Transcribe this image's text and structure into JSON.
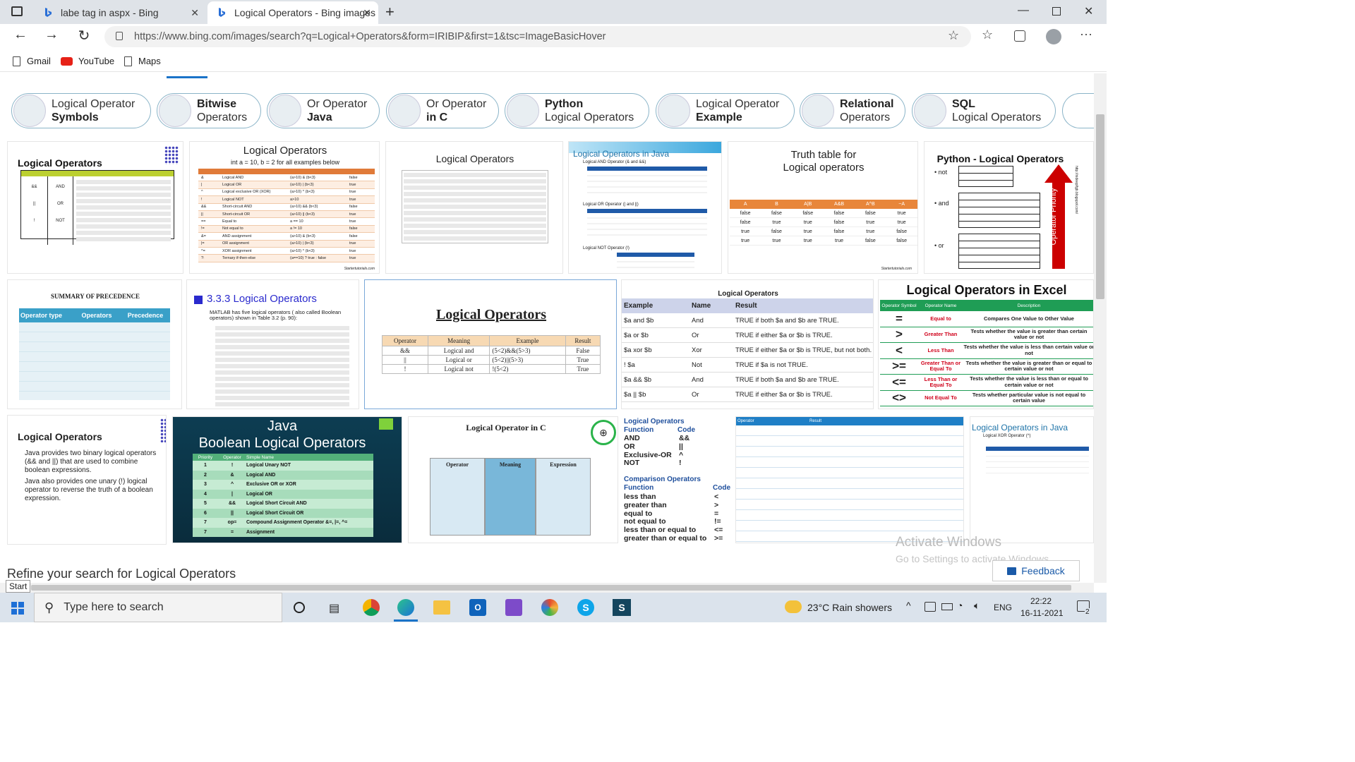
{
  "browser": {
    "tabs": [
      {
        "title": "labe tag in aspx - Bing",
        "active": false
      },
      {
        "title": "Logical Operators - Bing images",
        "active": true
      }
    ],
    "url": "https://www.bing.com/images/search?q=Logical+Operators&form=IRIBIP&first=1&tsc=ImageBasicHover",
    "bookmarks": [
      "Gmail",
      "YouTube",
      "Maps"
    ]
  },
  "related": [
    {
      "line1": "Logical Operator",
      "line2": "Symbols",
      "bold": 2
    },
    {
      "line1": "Bitwise",
      "line2": "Operators",
      "bold": 1
    },
    {
      "line1": "Or Operator",
      "line2": "Java",
      "bold": 2
    },
    {
      "line1": "Or Operator",
      "line2": "in C",
      "bold": 2
    },
    {
      "line1": "Python",
      "line2": "Logical Operators",
      "bold": 1
    },
    {
      "line1": "Logical Operator",
      "line2": "Example",
      "bold": 2
    },
    {
      "line1": "Relational",
      "line2": "Operators",
      "bold": 1
    },
    {
      "line1": "SQL",
      "line2": "Logical Operators",
      "bold": 1
    }
  ],
  "tiles": {
    "t1": {
      "title": "Logical Operators"
    },
    "t2": {
      "title": "Logical Operators",
      "sub": "int  a = 10, b = 2 for all examples below",
      "footer": "Startertutorials.com"
    },
    "t3": {
      "title": "Logical Operators"
    },
    "t4": {
      "title": "Logical Operators in Java",
      "a": "Logical AND Operator (& and &&)",
      "b": "Logical OR Operator (| and ||)",
      "c": "Logical NOT Operator (!)"
    },
    "t5": {
      "title": "Truth table for Logical operators",
      "footer": "Startertutorials.com"
    },
    "t6": {
      "title": "Python - Logical Operators",
      "side": "Operator Priority",
      "url": "http://nideeplfgb.blogspot.com/"
    },
    "t7": {
      "title": "SUMMARY OF PRECEDENCE",
      "cols": [
        "Operator type",
        "Operators",
        "Precedence"
      ]
    },
    "t8": {
      "title": "3.3.3 Logical Operators",
      "intro": "MATLAB has five logical operators ( also called Boolean operators) shown in Table 3.2 (p. 90):"
    },
    "t9": {
      "title": "Logical Operators",
      "cols": [
        "Operator",
        "Meaning",
        "Example",
        "Result"
      ]
    },
    "t10": {
      "title": "Logical Operators",
      "cols": [
        "Example",
        "Name",
        "Result"
      ]
    },
    "t11": {
      "title": "Logical Operators in Excel",
      "cols": [
        "Operator Symbol",
        "Operator Name",
        "Description"
      ]
    },
    "t12": {
      "title": "Logical Operators",
      "b1": "Java provides two binary logical operators (&& and ||) that are used to combine boolean expressions.",
      "b2": "Java also provides one unary (!) logical operator to reverse the truth of a boolean expression."
    },
    "t13": {
      "title1": "Java",
      "title2": "Boolean Logical Operators",
      "cols": [
        "Priority",
        "Operator",
        "Simple Name"
      ]
    },
    "t14": {
      "title": "Logical  Operator in C",
      "cols": [
        "Operator",
        "Meaning",
        "Expression"
      ]
    },
    "t15": {
      "h1": "Logical Operators",
      "h2": "Comparison Operators",
      "func": "Function",
      "code": "Code"
    },
    "t16": {
      "c1": "Operator",
      "c2": "Result"
    },
    "t17": {
      "title": "Logical Operators in Java",
      "sub": "Logical XOR Operator (^)"
    }
  },
  "t2rows": [
    [
      "&",
      "Logical AND",
      "(a>10) & (b<3)",
      "false"
    ],
    [
      "|",
      "Logical OR",
      "(a>10) | (b<3)",
      "true"
    ],
    [
      "^",
      "Logical exclusive OR (XOR)",
      "(a>10) ^ (b<3)",
      "true"
    ],
    [
      "!",
      "Logical NOT",
      "a>10",
      "true"
    ],
    [
      "&&",
      "Short-circuit AND",
      "(a>10) && (b<3)",
      "false"
    ],
    [
      "||",
      "Short-circuit OR",
      "(a>10) || (b<3)",
      "true"
    ],
    [
      "==",
      "Equal to",
      "a == 10",
      "true"
    ],
    [
      "!=",
      "Not equal to",
      "a != 10",
      "false"
    ],
    [
      "&=",
      "AND assignment",
      "(a>10) & (b<3)",
      "false"
    ],
    [
      "|=",
      "OR assignment",
      "(a>10) | (b<3)",
      "true"
    ],
    [
      "^=",
      "XOR assignment",
      "(a>10) ^ (b<3)",
      "true"
    ],
    [
      "?:",
      "Ternary if-then-else",
      "(a==10) ? true : false",
      "true"
    ]
  ],
  "t5head": [
    "A",
    "B",
    "A|B",
    "A&B",
    "A^B",
    "~A"
  ],
  "t5rows": [
    [
      "false",
      "false",
      "false",
      "false",
      "false",
      "true"
    ],
    [
      "false",
      "true",
      "true",
      "false",
      "true",
      "true"
    ],
    [
      "true",
      "false",
      "true",
      "false",
      "true",
      "false"
    ],
    [
      "true",
      "true",
      "true",
      "true",
      "false",
      "false"
    ]
  ],
  "t9rows": [
    [
      "&&",
      "Logical and",
      "(5<2)&&(5>3)",
      "False"
    ],
    [
      "||",
      "Logical or",
      "(5<2)||(5>3)",
      "True"
    ],
    [
      "!",
      "Logical not",
      "!(5<2)",
      "True"
    ]
  ],
  "t10rows": [
    [
      "$a and $b",
      "And",
      "TRUE if both $a and $b are TRUE."
    ],
    [
      "$a or $b",
      "Or",
      "TRUE if either $a or $b is TRUE."
    ],
    [
      "$a xor $b",
      "Xor",
      "TRUE if either $a or $b is TRUE, but not both."
    ],
    [
      "! $a",
      "Not",
      "TRUE if $a is not TRUE."
    ],
    [
      "$a && $b",
      "And",
      "TRUE if both $a and $b are TRUE."
    ],
    [
      "$a || $b",
      "Or",
      "TRUE if either $a or $b is TRUE."
    ]
  ],
  "t11rows": [
    [
      "=",
      "Equal to",
      "Compares One Value to Other Value"
    ],
    [
      ">",
      "Greater Than",
      "Tests whether the value is greater than certain value or not"
    ],
    [
      "<",
      "Less Than",
      "Tests whether the value is less than certain value or not"
    ],
    [
      ">=",
      "Greater Than or Equal To",
      "Tests whether the value is greater than or equal to certain value or not"
    ],
    [
      "<=",
      "Less Than or Equal To",
      "Tests whether the value is less than or equal to certain value or not"
    ],
    [
      "<>",
      "Not Equal To",
      "Tests whether particular value is not equal to certain value"
    ]
  ],
  "t13rows": [
    [
      "1",
      "!",
      "Logical Unary NOT"
    ],
    [
      "2",
      "&",
      "Logical AND"
    ],
    [
      "3",
      "^",
      "Exclusive OR or XOR"
    ],
    [
      "4",
      "|",
      "Logical OR"
    ],
    [
      "5",
      "&&",
      "Logical Short Circuit AND"
    ],
    [
      "6",
      "||",
      "Logical Short Circuit OR"
    ],
    [
      "7",
      "op=",
      "Compound Assignment Operator &=, |=, ^="
    ],
    [
      "7",
      "=",
      "Assignment"
    ]
  ],
  "t15logic": [
    [
      "AND",
      "&&"
    ],
    [
      "OR",
      "||"
    ],
    [
      "Exclusive-OR",
      "^"
    ],
    [
      "NOT",
      "!"
    ]
  ],
  "t15comp": [
    [
      "less than",
      "<"
    ],
    [
      "greater than",
      ">"
    ],
    [
      "equal to",
      "="
    ],
    [
      "not equal to",
      "!="
    ],
    [
      "less than or equal to",
      "<="
    ],
    [
      "greater than or equal to",
      ">="
    ]
  ],
  "refine": "Refine your search for Logical Operators",
  "feedback": "Feedback",
  "watermark": {
    "line1": "Activate Windows",
    "line2": "Go to Settings to activate Windows."
  },
  "status_tooltip": "Start",
  "taskbar": {
    "search": "Type here to search",
    "weather": "23°C  Rain showers",
    "lang": "ENG",
    "time": "22:22",
    "date": "16-11-2021",
    "notif": "2"
  }
}
